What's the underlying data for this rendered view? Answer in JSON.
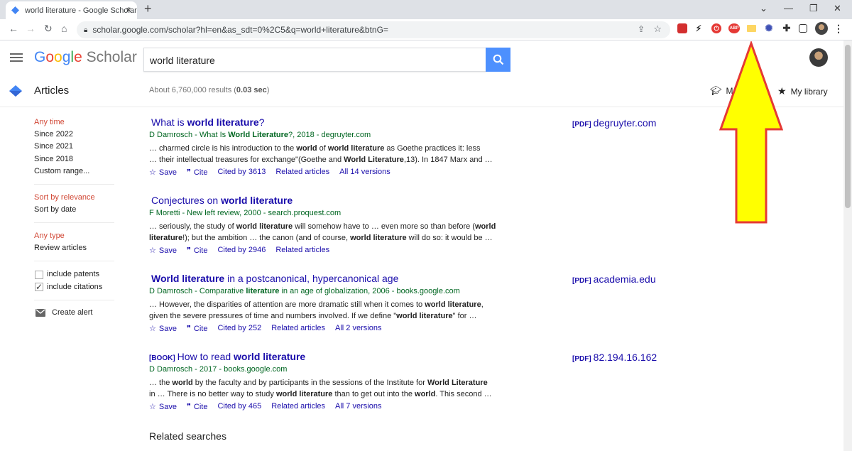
{
  "browser": {
    "tab_title": "world literature - Google Scholar",
    "url": "scholar.google.com/scholar?hl=en&as_sdt=0%2C5&q=world+literature&btnG=",
    "new_tab_symbol": "+",
    "close_symbol": "×",
    "ext_abp": "ABP"
  },
  "header": {
    "logo_google": "Google",
    "logo_scholar": "Scholar",
    "search_value": "world literature"
  },
  "subheader": {
    "section": "Articles",
    "results_prefix": "About 6,760,000 results (",
    "results_time": "0.03 sec",
    "results_suffix": ")",
    "my_profile": "M",
    "my_library": "My library"
  },
  "sidebar": {
    "time_items": [
      {
        "label": "Any time"
      },
      {
        "label": "Since 2022"
      },
      {
        "label": "Since 2021"
      },
      {
        "label": "Since 2018"
      },
      {
        "label": "Custom range..."
      }
    ],
    "sort_items": [
      {
        "label": "Sort by relevance"
      },
      {
        "label": "Sort by date"
      }
    ],
    "type_items": [
      {
        "label": "Any type"
      },
      {
        "label": "Review articles"
      }
    ],
    "include_patents": "include patents",
    "include_citations": "include citations",
    "create_alert": "Create alert"
  },
  "results": [
    {
      "title_pre": "What is ",
      "title_bold": "world literature",
      "title_post": "?",
      "tag": "",
      "authors": "D Damrosch - What Is World Literature?, 2018 - degruyter.com",
      "snippet1": "… charmed circle is his introduction to the world of world literature as Goethe practices it: less",
      "snippet2": "… their intellectual treasures for exchange\"(Goethe and World Literature,13). In 1847 Marx and …",
      "save": "Save",
      "cite": "Cite",
      "cited_by": "Cited by 3613",
      "related": "Related articles",
      "versions": "All 14 versions",
      "pdf_tag": "[PDF]",
      "pdf_source": "degruyter.com"
    },
    {
      "title_pre": "Conjectures on ",
      "title_bold": "world literature",
      "title_post": "",
      "tag": "",
      "authors": "F Moretti - New left review, 2000 - search.proquest.com",
      "snippet1": "… seriously, the study of world literature will somehow have to … even more so than before (world",
      "snippet2": "literature!); but the ambition … the canon (and of course, world literature will do so: it would be …",
      "save": "Save",
      "cite": "Cite",
      "cited_by": "Cited by 2946",
      "related": "Related articles",
      "versions": "",
      "pdf_tag": "",
      "pdf_source": ""
    },
    {
      "title_pre": "",
      "title_bold": "World literature",
      "title_post": " in a postcanonical, hypercanonical age",
      "tag": "",
      "authors": "D Damrosch - Comparative literature in an age of globalization, 2006 - books.google.com",
      "snippet1": "… However, the disparities of attention are more dramatic still when it comes to world literature,",
      "snippet2": "given the severe pressures of time and numbers involved. If we define \"world literature\" for …",
      "save": "Save",
      "cite": "Cite",
      "cited_by": "Cited by 252",
      "related": "Related articles",
      "versions": "All 2 versions",
      "pdf_tag": "[PDF]",
      "pdf_source": "academia.edu"
    },
    {
      "title_pre": "How to read ",
      "title_bold": "world literature",
      "title_post": "",
      "tag": "[BOOK]",
      "authors": "D Damrosch - 2017 - books.google.com",
      "snippet1": "… the world by the faculty and by participants in the sessions of the Institute for World Literature",
      "snippet2": "in … There is no better way to study world literature than to get out into the world. This second …",
      "save": "Save",
      "cite": "Cite",
      "cited_by": "Cited by 465",
      "related": "Related articles",
      "versions": "All 7 versions",
      "pdf_tag": "[PDF]",
      "pdf_source": "82.194.16.162"
    }
  ],
  "related_searches": "Related searches",
  "colors": {
    "link": "#1a0dab",
    "green": "#006621",
    "red": "#d14836",
    "search_button": "#4d90fe",
    "arrow_fill": "#ffff00",
    "arrow_stroke": "#e53935"
  }
}
